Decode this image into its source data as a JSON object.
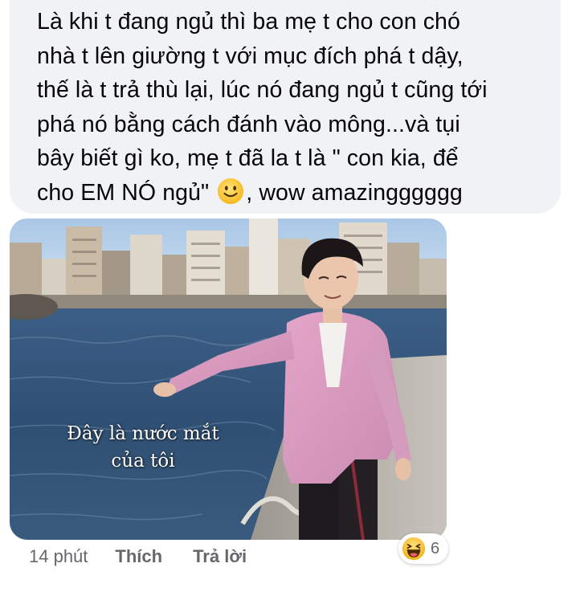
{
  "comment": {
    "line_1": "Là khi t đang ngủ thì ba mẹ t cho con chó",
    "line_2": "nhà t lên giường t với mục đích phá t dậy,",
    "line_3": "thế là t trả thù lại, lúc nó đang ngủ t cũng tới",
    "line_4": "phá nó bằng cách đánh vào mông...và tụi",
    "line_5": "bây biết gì ko, mẹ t đã la t là \" con kia, để",
    "line_6_before_emoji": "cho EM NÓ ngủ\" ",
    "inline_emoji": "slightly-smiling-face",
    "line_6_after_emoji": ", wow amazingggggg"
  },
  "photo": {
    "caption_line_1": "Đây là nước mắt",
    "caption_line_2": "của tôi"
  },
  "meta": {
    "time": "14 phút",
    "like_label": "Thích",
    "reply_label": "Trả lời"
  },
  "reactions": {
    "icon": "haha-reaction",
    "count": "6"
  },
  "colors": {
    "bubble_background": "#f0f2f5",
    "text": "#050505",
    "meta_text": "#65676b"
  }
}
